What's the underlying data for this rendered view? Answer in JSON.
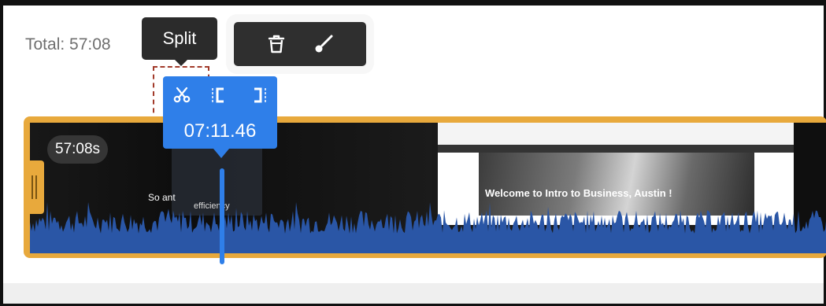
{
  "header": {
    "total_label": "Total: 57:08"
  },
  "tooltip": {
    "text": "Split"
  },
  "toolbar": {
    "icons": [
      "trash-icon",
      "brush-icon"
    ]
  },
  "clip": {
    "duration_badge": "57:08s",
    "left_thumbnail_text": "So        ant",
    "left_thumbnail_subtext": "efficiency",
    "right_thumbnail_caption": "Welcome to Intro to Business, Austin !"
  },
  "playhead": {
    "time": "07:11.46",
    "tools": [
      "scissors-icon",
      "trim-start-icon",
      "trim-end-icon"
    ]
  },
  "colors": {
    "accent_blue": "#2f7fe9",
    "track_orange": "#e8a93c",
    "waveform_blue": "#2a56a6",
    "tooltip_bg": "#2b2b2b"
  }
}
